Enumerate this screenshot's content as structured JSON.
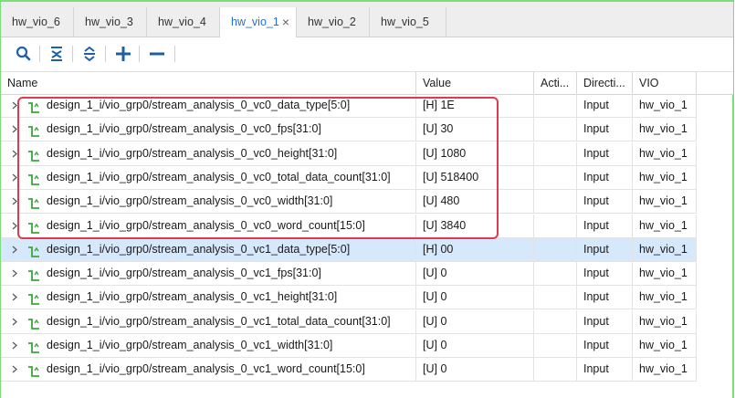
{
  "tabs": [
    {
      "label": "hw_vio_6",
      "active": false
    },
    {
      "label": "hw_vio_3",
      "active": false
    },
    {
      "label": "hw_vio_4",
      "active": false
    },
    {
      "label": "hw_vio_1",
      "active": true,
      "close": "×"
    },
    {
      "label": "hw_vio_2",
      "active": false
    },
    {
      "label": "hw_vio_5",
      "active": false
    }
  ],
  "toolbar": {
    "buttons": [
      "search-icon",
      "collapse-all-icon",
      "expand-all-icon",
      "add-icon",
      "remove-icon"
    ]
  },
  "columns": [
    "Name",
    "Value",
    "Acti...",
    "Directi...",
    "VIO"
  ],
  "rows": [
    {
      "name": "design_1_i/vio_grp0/stream_analysis_0_vc0_data_type[5:0]",
      "value": "[H] 1E",
      "activity": "",
      "direction": "Input",
      "vio": "hw_vio_1"
    },
    {
      "name": "design_1_i/vio_grp0/stream_analysis_0_vc0_fps[31:0]",
      "value": "[U] 30",
      "activity": "",
      "direction": "Input",
      "vio": "hw_vio_1"
    },
    {
      "name": "design_1_i/vio_grp0/stream_analysis_0_vc0_height[31:0]",
      "value": "[U] 1080",
      "activity": "",
      "direction": "Input",
      "vio": "hw_vio_1"
    },
    {
      "name": "design_1_i/vio_grp0/stream_analysis_0_vc0_total_data_count[31:0]",
      "value": "[U] 518400",
      "activity": "",
      "direction": "Input",
      "vio": "hw_vio_1"
    },
    {
      "name": "design_1_i/vio_grp0/stream_analysis_0_vc0_width[31:0]",
      "value": "[U] 480",
      "activity": "",
      "direction": "Input",
      "vio": "hw_vio_1"
    },
    {
      "name": "design_1_i/vio_grp0/stream_analysis_0_vc0_word_count[15:0]",
      "value": "[U] 3840",
      "activity": "",
      "direction": "Input",
      "vio": "hw_vio_1"
    },
    {
      "name": "design_1_i/vio_grp0/stream_analysis_0_vc1_data_type[5:0]",
      "value": "[H] 00",
      "activity": "",
      "direction": "Input",
      "vio": "hw_vio_1",
      "selected": true
    },
    {
      "name": "design_1_i/vio_grp0/stream_analysis_0_vc1_fps[31:0]",
      "value": "[U] 0",
      "activity": "",
      "direction": "Input",
      "vio": "hw_vio_1"
    },
    {
      "name": "design_1_i/vio_grp0/stream_analysis_0_vc1_height[31:0]",
      "value": "[U] 0",
      "activity": "",
      "direction": "Input",
      "vio": "hw_vio_1"
    },
    {
      "name": "design_1_i/vio_grp0/stream_analysis_0_vc1_total_data_count[31:0]",
      "value": "[U] 0",
      "activity": "",
      "direction": "Input",
      "vio": "hw_vio_1"
    },
    {
      "name": "design_1_i/vio_grp0/stream_analysis_0_vc1_width[31:0]",
      "value": "[U] 0",
      "activity": "",
      "direction": "Input",
      "vio": "hw_vio_1"
    },
    {
      "name": "design_1_i/vio_grp0/stream_analysis_0_vc1_word_count[15:0]",
      "value": "[U] 0",
      "activity": "",
      "direction": "Input",
      "vio": "hw_vio_1"
    }
  ],
  "colors": {
    "frame_border": "#79e079",
    "active_tab_text": "#1e6fd9",
    "toolbar_icon": "#1e5fa8",
    "selected_row": "#d6e8fb",
    "highlight_box": "#e2394f",
    "probe_icon": "#3aa63a"
  }
}
